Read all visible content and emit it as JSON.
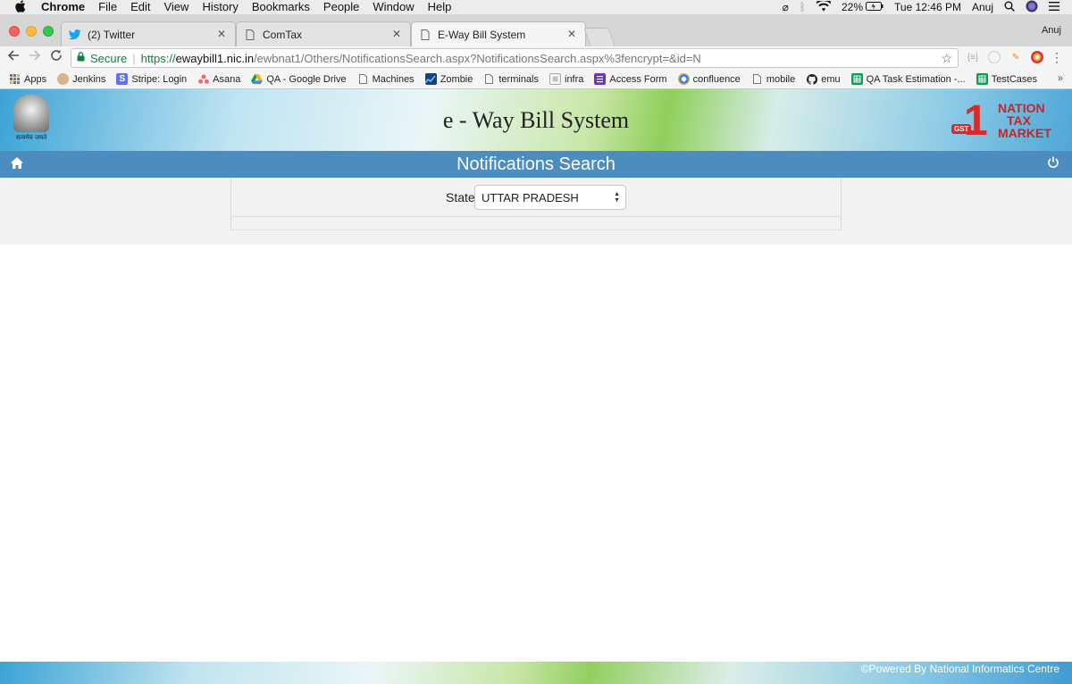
{
  "menubar": {
    "app": "Chrome",
    "items": [
      "File",
      "Edit",
      "View",
      "History",
      "Bookmarks",
      "People",
      "Window",
      "Help"
    ],
    "battery": "22%",
    "clock": "Tue 12:46 PM",
    "user": "Anuj"
  },
  "tabs": [
    {
      "label": "(2) Twitter",
      "icon": "twitter-bird-icon"
    },
    {
      "label": "ComTax",
      "icon": "page-icon"
    },
    {
      "label": "E-Way Bill System",
      "icon": "page-icon"
    }
  ],
  "profile_name": "Anuj",
  "address": {
    "secure_label": "Secure",
    "url_scheme": "https://",
    "url_host": "ewaybill1.nic.in",
    "url_path": "/ewbnat1/Others/NotificationsSearch.aspx?NotificationsSearch.aspx%3fencrypt=&id=N"
  },
  "bookmarks": [
    {
      "label": "Apps",
      "icon": "apps-grid-icon",
      "color": "#e74c3c"
    },
    {
      "label": "Jenkins",
      "icon": "jenkins-icon",
      "color": "#c8a070"
    },
    {
      "label": "Stripe: Login",
      "icon": "stripe-icon",
      "color": "#6772e5"
    },
    {
      "label": "Asana",
      "icon": "asana-icon",
      "color": "#f06a6a"
    },
    {
      "label": "QA - Google Drive",
      "icon": "google-drive-icon",
      "color": "#1fa463"
    },
    {
      "label": "Machines",
      "icon": "page-icon",
      "color": "#888888"
    },
    {
      "label": "Zombie",
      "icon": "chart-icon",
      "color": "#2f6fb5"
    },
    {
      "label": "terminals",
      "icon": "page-icon",
      "color": "#888888"
    },
    {
      "label": "infra",
      "icon": "broken-image-icon",
      "color": "#999999"
    },
    {
      "label": "Access Form",
      "icon": "form-icon",
      "color": "#673ab7"
    },
    {
      "label": "confluence",
      "icon": "confluence-icon",
      "color": "#2684ff"
    },
    {
      "label": "mobile",
      "icon": "page-icon",
      "color": "#888888"
    },
    {
      "label": "emu",
      "icon": "github-icon",
      "color": "#222222"
    },
    {
      "label": "QA Task Estimation -...",
      "icon": "sheets-icon",
      "color": "#0f9d58"
    },
    {
      "label": "TestCases",
      "icon": "sheets-icon",
      "color": "#0f9d58"
    }
  ],
  "site": {
    "title": "e - Way Bill System",
    "emblem_motto": "सत्यमेव जयते",
    "gst_tag": "GST",
    "gst_lines": [
      "NATION",
      "TAX",
      "MARKET"
    ]
  },
  "page": {
    "title": "Notifications Search",
    "state_label": "State",
    "state_value": "UTTAR PRADESH"
  },
  "footer": {
    "text": "©Powered By National Informatics Centre"
  },
  "colors": {
    "navbar": "#4d8cbf",
    "secure": "#0b8043",
    "gst_red": "#d62b2b"
  }
}
